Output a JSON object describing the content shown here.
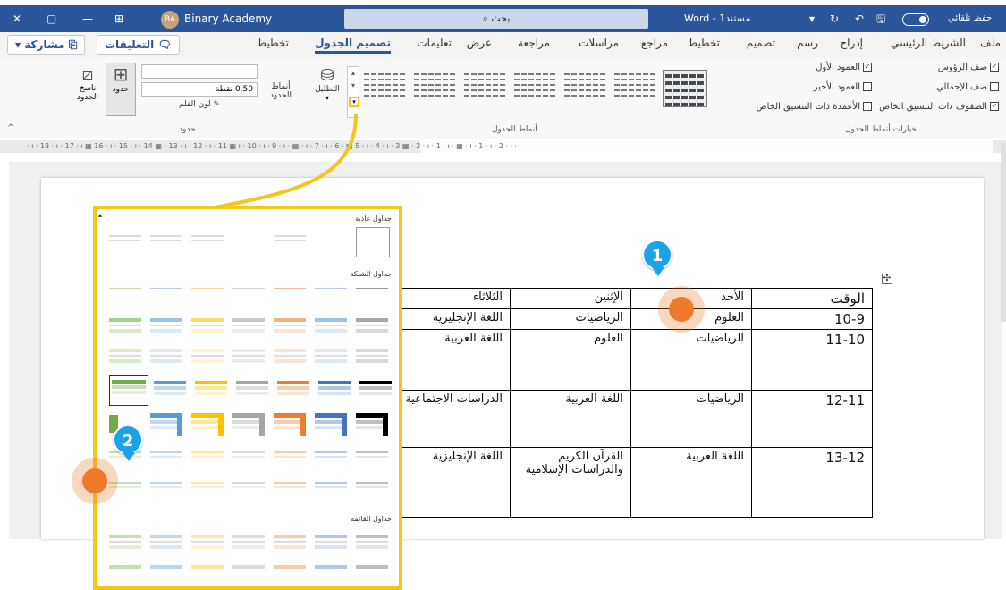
{
  "titlebar": {
    "app_name": "Binary Academy",
    "avatar_initials": "BA",
    "search_placeholder": "بحث",
    "doc_title": "Word - مستند1",
    "autosave_label": "حفظ تلقائي",
    "close_glyph": "✕",
    "restore_glyph": "▢",
    "minimize_glyph": "—",
    "layout_glyph": "⊞"
  },
  "tabs": {
    "items": [
      "ملف",
      "الشريط الرئيسي",
      "إدراج",
      "رسم",
      "تصميم",
      "تخطيط",
      "مراجع",
      "مراسلات",
      "مراجعة",
      "عرض",
      "تعليمات",
      "تصميم الجدول",
      "تخطيط"
    ],
    "active": "تصميم الجدول",
    "comments_label": "التعليقات",
    "share_label": "مشاركة"
  },
  "ribbon": {
    "options": {
      "header_row": "صف الرؤوس",
      "first_column": "العمود الأول",
      "total_row": "صف الإجمالي",
      "last_column": "العمود الأخير",
      "banded_rows": "الصفوف ذات التنسيق الخاص",
      "banded_columns": "الأعمدة ذات التنسيق الخاص",
      "group_label": "خيارات أنماط الجدول"
    },
    "styles_group_label": "أنماط الجدول",
    "shading_label": "التظليل",
    "borders_group_label": "حدود",
    "border_styles_label": "أنماط الحدود",
    "pen_weight": "0.50 نقطة",
    "pen_color": "لون القلم",
    "borders_label": "حدود",
    "border_painter_label": "ناسخ الحدود"
  },
  "ruler": {
    "text": "· ı · 18 · ı · 17 · ı ▦ 16 · ı · 15 · ı · 14 ▦ · 13 · ı · 12 · ı · 11 ▦ ı · 10 · ı · 9 · ı · ▦ · ı · 7 · ı · 6 · ▦ 5 · ı · 4 · ı · 3 ▦ · 2 · ı · 1 · ı · ▦ · ı · 1 · ı · 2 · ı ·"
  },
  "table": {
    "headers": [
      "الوقت",
      "الأحد",
      "الإثنين",
      "الثلاثاء"
    ],
    "rows": [
      [
        "10-9",
        "العلوم",
        "الرياضيات",
        "اللغة الإنجليزية"
      ],
      [
        "11-10",
        "الرياضيات",
        "العلوم",
        "اللغة العربية"
      ],
      [
        "12-11",
        "الرياضيات",
        "اللغة العربية",
        "الدراسات الاجتماعية"
      ],
      [
        "13-12",
        "اللغة العربية",
        "القرآن الكريم والدراسات الإسلامية",
        "اللغة الإنجليزية"
      ]
    ]
  },
  "gallery_panel": {
    "plain_tables": "جداول عادية",
    "grid_tables": "جداول الشبكة",
    "list_tables": "جداول القائمة"
  },
  "callouts": {
    "step1": "1",
    "step2": "2"
  },
  "colors": {
    "brand": "#2b579a",
    "callout_border": "#f5c518",
    "badge": "#1aa3e8",
    "click_dot": "#f07a2c"
  }
}
